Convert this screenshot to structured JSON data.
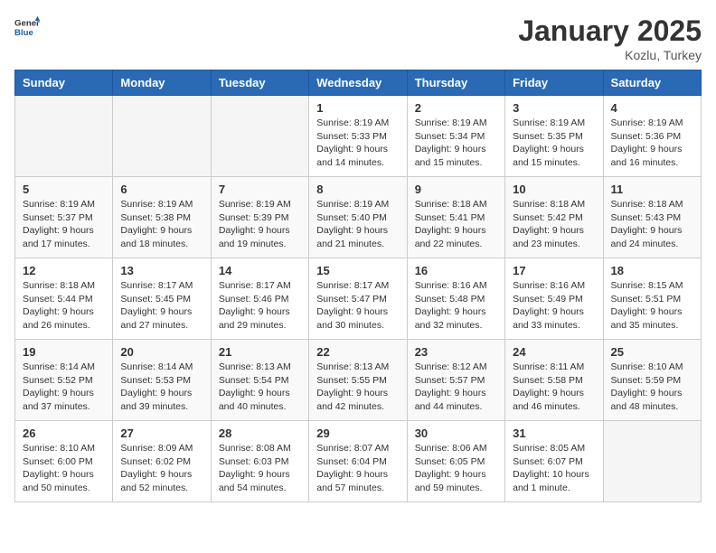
{
  "header": {
    "logo_general": "General",
    "logo_blue": "Blue",
    "month_title": "January 2025",
    "location": "Kozlu, Turkey"
  },
  "days_of_week": [
    "Sunday",
    "Monday",
    "Tuesday",
    "Wednesday",
    "Thursday",
    "Friday",
    "Saturday"
  ],
  "weeks": [
    [
      {
        "day": "",
        "info": ""
      },
      {
        "day": "",
        "info": ""
      },
      {
        "day": "",
        "info": ""
      },
      {
        "day": "1",
        "info": "Sunrise: 8:19 AM\nSunset: 5:33 PM\nDaylight: 9 hours\nand 14 minutes."
      },
      {
        "day": "2",
        "info": "Sunrise: 8:19 AM\nSunset: 5:34 PM\nDaylight: 9 hours\nand 15 minutes."
      },
      {
        "day": "3",
        "info": "Sunrise: 8:19 AM\nSunset: 5:35 PM\nDaylight: 9 hours\nand 15 minutes."
      },
      {
        "day": "4",
        "info": "Sunrise: 8:19 AM\nSunset: 5:36 PM\nDaylight: 9 hours\nand 16 minutes."
      }
    ],
    [
      {
        "day": "5",
        "info": "Sunrise: 8:19 AM\nSunset: 5:37 PM\nDaylight: 9 hours\nand 17 minutes."
      },
      {
        "day": "6",
        "info": "Sunrise: 8:19 AM\nSunset: 5:38 PM\nDaylight: 9 hours\nand 18 minutes."
      },
      {
        "day": "7",
        "info": "Sunrise: 8:19 AM\nSunset: 5:39 PM\nDaylight: 9 hours\nand 19 minutes."
      },
      {
        "day": "8",
        "info": "Sunrise: 8:19 AM\nSunset: 5:40 PM\nDaylight: 9 hours\nand 21 minutes."
      },
      {
        "day": "9",
        "info": "Sunrise: 8:18 AM\nSunset: 5:41 PM\nDaylight: 9 hours\nand 22 minutes."
      },
      {
        "day": "10",
        "info": "Sunrise: 8:18 AM\nSunset: 5:42 PM\nDaylight: 9 hours\nand 23 minutes."
      },
      {
        "day": "11",
        "info": "Sunrise: 8:18 AM\nSunset: 5:43 PM\nDaylight: 9 hours\nand 24 minutes."
      }
    ],
    [
      {
        "day": "12",
        "info": "Sunrise: 8:18 AM\nSunset: 5:44 PM\nDaylight: 9 hours\nand 26 minutes."
      },
      {
        "day": "13",
        "info": "Sunrise: 8:17 AM\nSunset: 5:45 PM\nDaylight: 9 hours\nand 27 minutes."
      },
      {
        "day": "14",
        "info": "Sunrise: 8:17 AM\nSunset: 5:46 PM\nDaylight: 9 hours\nand 29 minutes."
      },
      {
        "day": "15",
        "info": "Sunrise: 8:17 AM\nSunset: 5:47 PM\nDaylight: 9 hours\nand 30 minutes."
      },
      {
        "day": "16",
        "info": "Sunrise: 8:16 AM\nSunset: 5:48 PM\nDaylight: 9 hours\nand 32 minutes."
      },
      {
        "day": "17",
        "info": "Sunrise: 8:16 AM\nSunset: 5:49 PM\nDaylight: 9 hours\nand 33 minutes."
      },
      {
        "day": "18",
        "info": "Sunrise: 8:15 AM\nSunset: 5:51 PM\nDaylight: 9 hours\nand 35 minutes."
      }
    ],
    [
      {
        "day": "19",
        "info": "Sunrise: 8:14 AM\nSunset: 5:52 PM\nDaylight: 9 hours\nand 37 minutes."
      },
      {
        "day": "20",
        "info": "Sunrise: 8:14 AM\nSunset: 5:53 PM\nDaylight: 9 hours\nand 39 minutes."
      },
      {
        "day": "21",
        "info": "Sunrise: 8:13 AM\nSunset: 5:54 PM\nDaylight: 9 hours\nand 40 minutes."
      },
      {
        "day": "22",
        "info": "Sunrise: 8:13 AM\nSunset: 5:55 PM\nDaylight: 9 hours\nand 42 minutes."
      },
      {
        "day": "23",
        "info": "Sunrise: 8:12 AM\nSunset: 5:57 PM\nDaylight: 9 hours\nand 44 minutes."
      },
      {
        "day": "24",
        "info": "Sunrise: 8:11 AM\nSunset: 5:58 PM\nDaylight: 9 hours\nand 46 minutes."
      },
      {
        "day": "25",
        "info": "Sunrise: 8:10 AM\nSunset: 5:59 PM\nDaylight: 9 hours\nand 48 minutes."
      }
    ],
    [
      {
        "day": "26",
        "info": "Sunrise: 8:10 AM\nSunset: 6:00 PM\nDaylight: 9 hours\nand 50 minutes."
      },
      {
        "day": "27",
        "info": "Sunrise: 8:09 AM\nSunset: 6:02 PM\nDaylight: 9 hours\nand 52 minutes."
      },
      {
        "day": "28",
        "info": "Sunrise: 8:08 AM\nSunset: 6:03 PM\nDaylight: 9 hours\nand 54 minutes."
      },
      {
        "day": "29",
        "info": "Sunrise: 8:07 AM\nSunset: 6:04 PM\nDaylight: 9 hours\nand 57 minutes."
      },
      {
        "day": "30",
        "info": "Sunrise: 8:06 AM\nSunset: 6:05 PM\nDaylight: 9 hours\nand 59 minutes."
      },
      {
        "day": "31",
        "info": "Sunrise: 8:05 AM\nSunset: 6:07 PM\nDaylight: 10 hours\nand 1 minute."
      },
      {
        "day": "",
        "info": ""
      }
    ]
  ]
}
